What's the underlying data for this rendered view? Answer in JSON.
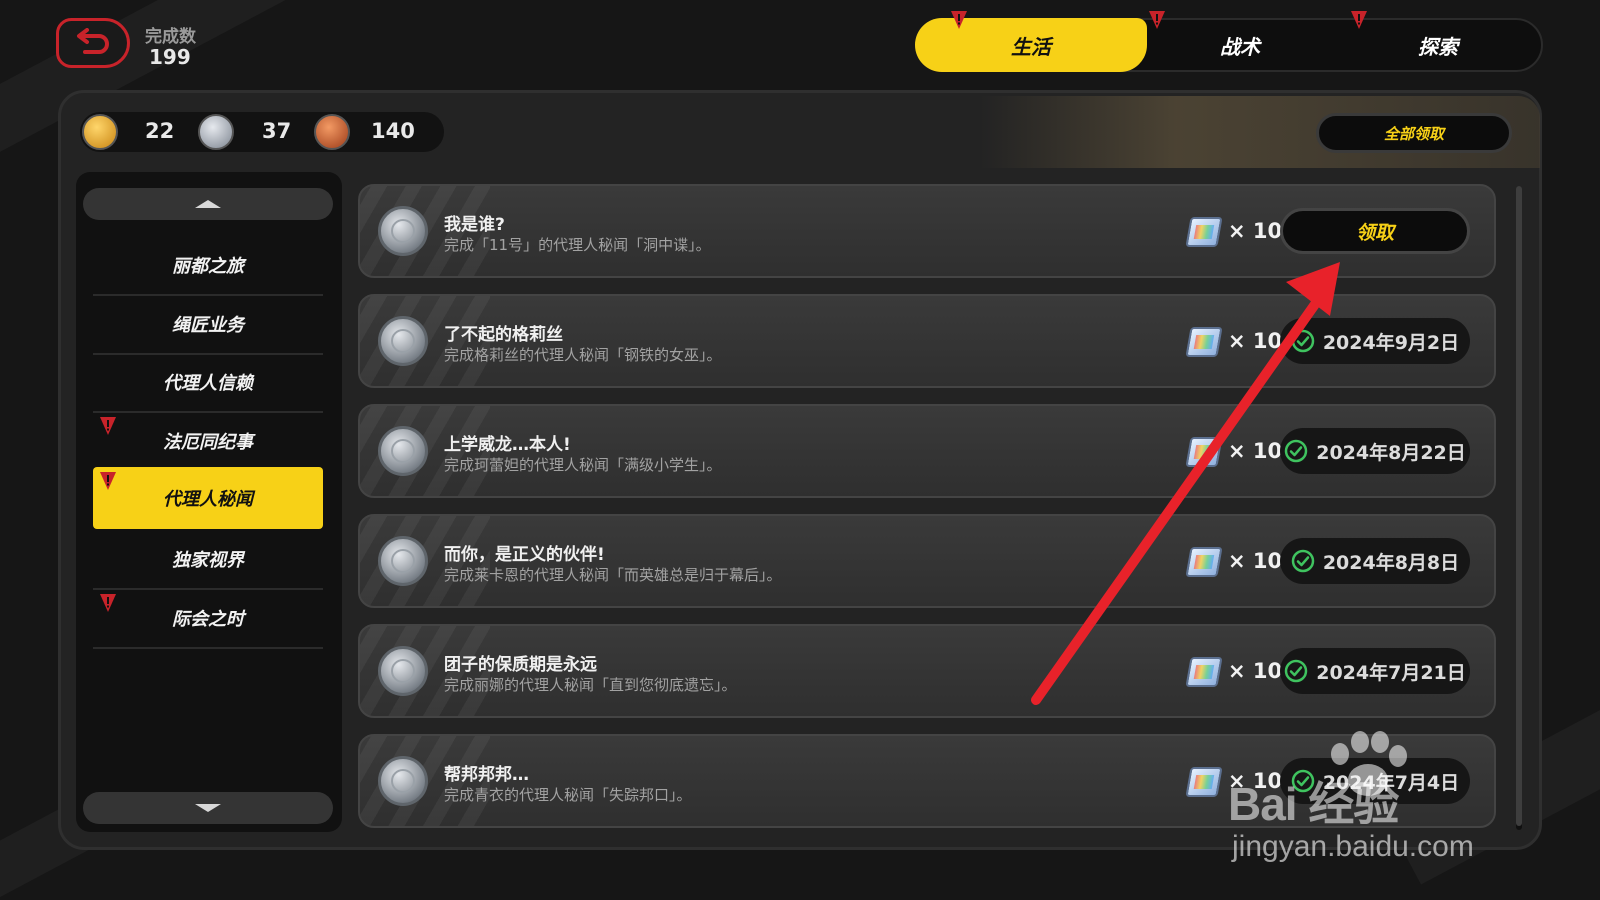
{
  "header": {
    "done_label": "完成数",
    "done_count": "199",
    "tabs": [
      {
        "label": "生活",
        "active": true
      },
      {
        "label": "战术",
        "active": false
      },
      {
        "label": "探索",
        "active": false
      }
    ]
  },
  "currency": [
    {
      "icon": "gold-medal-icon",
      "value": "22"
    },
    {
      "icon": "silver-medal-icon",
      "value": "37"
    },
    {
      "icon": "bronze-medal-icon",
      "value": "140"
    }
  ],
  "claim_all_label": "全部领取",
  "sidebar": {
    "items": [
      {
        "label": "丽都之旅",
        "alert": false,
        "active": false
      },
      {
        "label": "绳匠业务",
        "alert": false,
        "active": false
      },
      {
        "label": "代理人信赖",
        "alert": false,
        "active": false
      },
      {
        "label": "法厄同纪事",
        "alert": true,
        "active": false
      },
      {
        "label": "代理人秘闻",
        "alert": true,
        "active": true
      },
      {
        "label": "独家视界",
        "alert": false,
        "active": false
      },
      {
        "label": "际会之时",
        "alert": true,
        "active": false
      }
    ]
  },
  "tasks": [
    {
      "title": "我是谁?",
      "desc": "完成「11号」的代理人秘闻「洞中谍」。",
      "reward_qty": "× 10",
      "status": "claim",
      "claim_label": "领取",
      "date": ""
    },
    {
      "title": "了不起的格莉丝",
      "desc": "完成格莉丝的代理人秘闻「钢铁的女巫」。",
      "reward_qty": "× 10",
      "status": "done",
      "claim_label": "",
      "date": "2024年9月2日"
    },
    {
      "title": "上学威龙…本人!",
      "desc": "完成珂蕾妲的代理人秘闻「满级小学生」。",
      "reward_qty": "× 10",
      "status": "done",
      "claim_label": "",
      "date": "2024年8月22日"
    },
    {
      "title": "而你，是正义的伙伴!",
      "desc": "完成莱卡恩的代理人秘闻「而英雄总是归于幕后」。",
      "reward_qty": "× 10",
      "status": "done",
      "claim_label": "",
      "date": "2024年8月8日"
    },
    {
      "title": "团子的保质期是永远",
      "desc": "完成丽娜的代理人秘闻「直到您彻底遗忘」。",
      "reward_qty": "× 10",
      "status": "done",
      "claim_label": "",
      "date": "2024年7月21日"
    },
    {
      "title": "帮邦邦邦…",
      "desc": "完成青衣的代理人秘闻「失踪邦口」。",
      "reward_qty": "× 10",
      "status": "done",
      "claim_label": "",
      "date": "2024年7月4日"
    }
  ],
  "watermark": {
    "logo": "Bai  经验",
    "url": "jingyan.baidu.com"
  },
  "colors": {
    "accent_yellow": "#f7d117",
    "alert_red": "#c8232a",
    "check_green": "#3fc35f",
    "arrow_red": "#e8222a"
  }
}
